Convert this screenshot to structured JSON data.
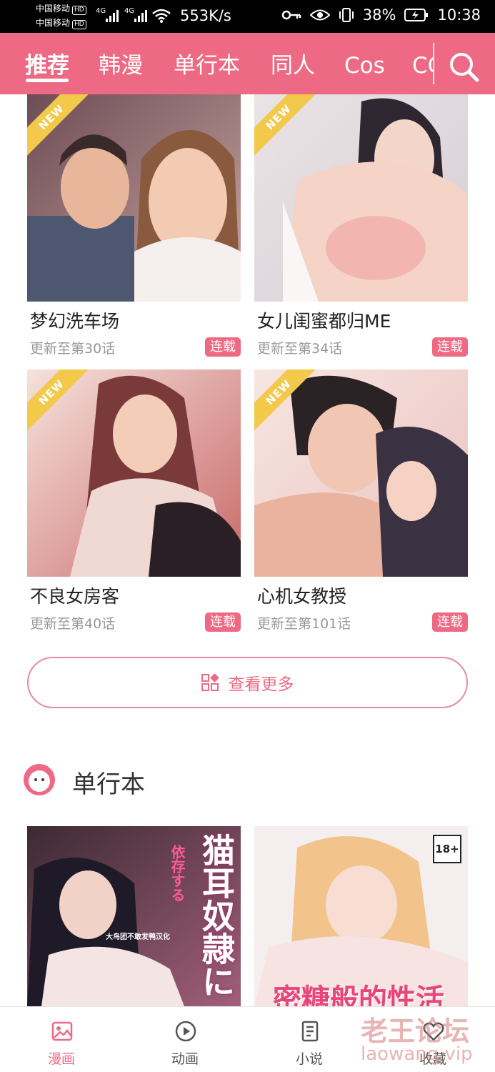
{
  "status_bar": {
    "carrier_1": "中国移动",
    "carrier_2": "中国移动",
    "hd_1": "HD",
    "hd_2": "HD",
    "net_1": "4G",
    "net_2": "4G",
    "speed": "553K/s",
    "battery": "38%",
    "time": "10:38"
  },
  "header": {
    "tabs": [
      {
        "label": "推荐"
      },
      {
        "label": "韩漫"
      },
      {
        "label": "单行本"
      },
      {
        "label": "同人"
      },
      {
        "label": "Cos"
      },
      {
        "label": "CG"
      }
    ],
    "active_tab": "推荐"
  },
  "comics": [
    {
      "title": "梦幻洗车场",
      "update": "更新至第30话",
      "badge": "连载",
      "ribbon": "NEW"
    },
    {
      "title": "女儿闺蜜都归ME",
      "update": "更新至第34话",
      "badge": "连载",
      "ribbon": "NEW"
    },
    {
      "title": "不良女房客",
      "update": "更新至第40话",
      "badge": "连载",
      "ribbon": "NEW"
    },
    {
      "title": "心机女教授",
      "update": "更新至第101话",
      "badge": "连载",
      "ribbon": "NEW"
    }
  ],
  "more_button": {
    "label": "查看更多"
  },
  "section": {
    "title": "单行本"
  },
  "volumes": [
    {
      "cover_text": "猫耳奴隷に",
      "cover_sub": "依存する",
      "cover_tag": "大鸟团不敢发鸭汉化"
    },
    {
      "cover_text": "密糖般的性活",
      "cover_tag": "18+"
    }
  ],
  "bottom_nav": [
    {
      "label": "漫画",
      "icon": "image-icon"
    },
    {
      "label": "动画",
      "icon": "play-circle-icon"
    },
    {
      "label": "小说",
      "icon": "book-icon"
    },
    {
      "label": "收藏",
      "icon": "heart-icon"
    }
  ],
  "watermark": {
    "text": "老王论坛",
    "url": "laowang.vip"
  },
  "colors": {
    "accent": "#ee6a84",
    "ribbon": "#f3c94b",
    "border": "#e68ca0"
  }
}
